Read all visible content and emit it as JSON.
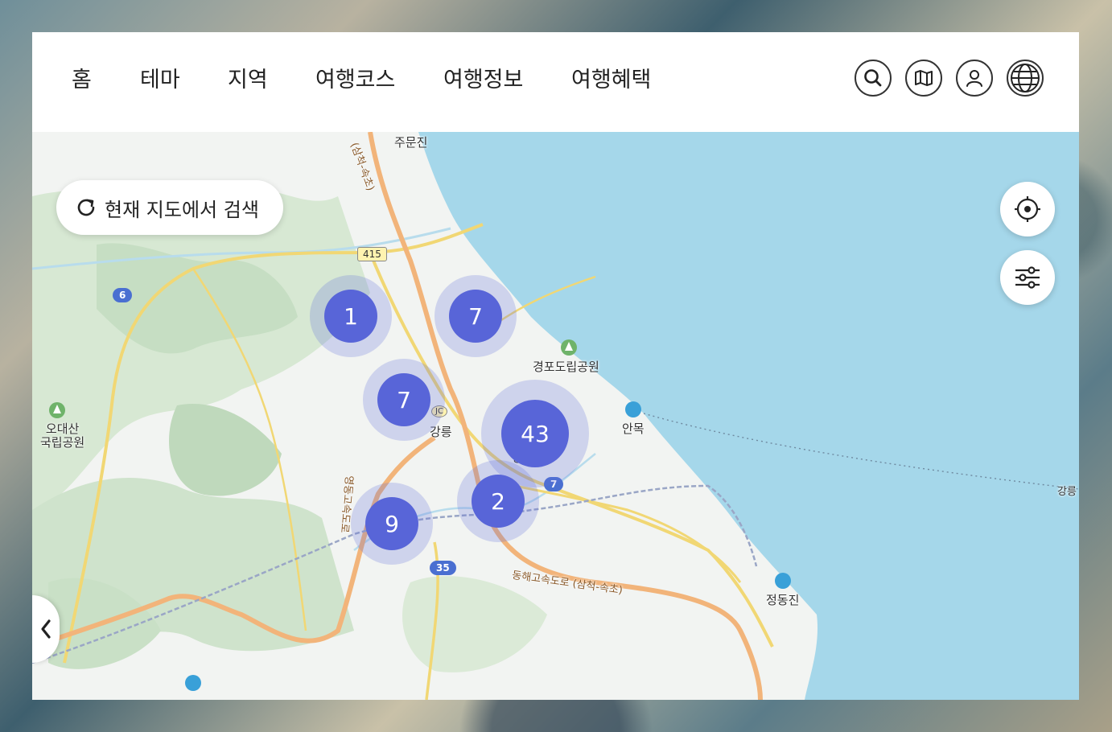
{
  "nav": {
    "items": [
      "홈",
      "테마",
      "지역",
      "여행코스",
      "여행정보",
      "여행혜택"
    ]
  },
  "header_icons": [
    "search-icon",
    "map-icon",
    "user-icon",
    "globe-icon"
  ],
  "map": {
    "search_here_label": "현재 지도에서 검색",
    "clusters": [
      {
        "count": "1"
      },
      {
        "count": "7"
      },
      {
        "count": "7"
      },
      {
        "count": "43"
      },
      {
        "count": "2"
      },
      {
        "count": "9"
      }
    ],
    "place_labels": {
      "jumunjin": "주문진",
      "gyeongpo": "경포도립공원",
      "odaesan_line1": "오대산",
      "odaesan_line2": "국립공원",
      "anmok": "안목",
      "gangneung_jc": "강릉",
      "gangneung_city": "강릉",
      "jeongdongjin": "정동진",
      "gangneung_ferry": "강릉",
      "donghae_expressway": "동해고속도로 (삼척-속초)",
      "north_expressway": "(삼척-속초)",
      "yeongdong_expressway": "영동고속도로"
    },
    "road_badges": {
      "route6": "6",
      "route415": "415",
      "route7": "7",
      "route35": "35",
      "jc": "JC"
    },
    "colors": {
      "sea": "#a5d7ea",
      "land": "#f2f4f2",
      "forest": "#cfe3cc",
      "expressway": "#f2b47a",
      "national_road": "#f1d774",
      "cluster": "#5865d8"
    }
  }
}
